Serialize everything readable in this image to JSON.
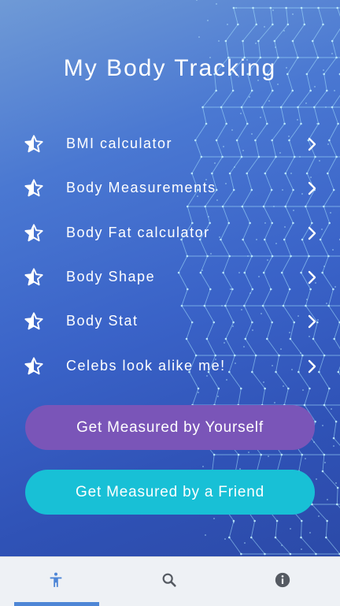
{
  "app": {
    "title": "My Body Tracking"
  },
  "menu": {
    "items": [
      {
        "label": "BMI calculator"
      },
      {
        "label": "Body Measurements"
      },
      {
        "label": "Body Fat calculator"
      },
      {
        "label": "Body Shape"
      },
      {
        "label": "Body Stat"
      },
      {
        "label": "Celebs look alike me!"
      }
    ]
  },
  "buttons": {
    "measure_self": "Get Measured by Yourself",
    "measure_friend": "Get Measured by a Friend"
  },
  "bottom_nav": {
    "tabs": [
      {
        "icon": "accessibility-icon",
        "active": true
      },
      {
        "icon": "search-icon",
        "active": false
      },
      {
        "icon": "info-icon",
        "active": false
      }
    ]
  },
  "colors": {
    "background_top": "#6f9ad6",
    "background_bottom": "#2c4aa8",
    "button_purple": "#7a55b8",
    "button_cyan": "#18c0d6",
    "nav_active": "#4e86d6"
  }
}
